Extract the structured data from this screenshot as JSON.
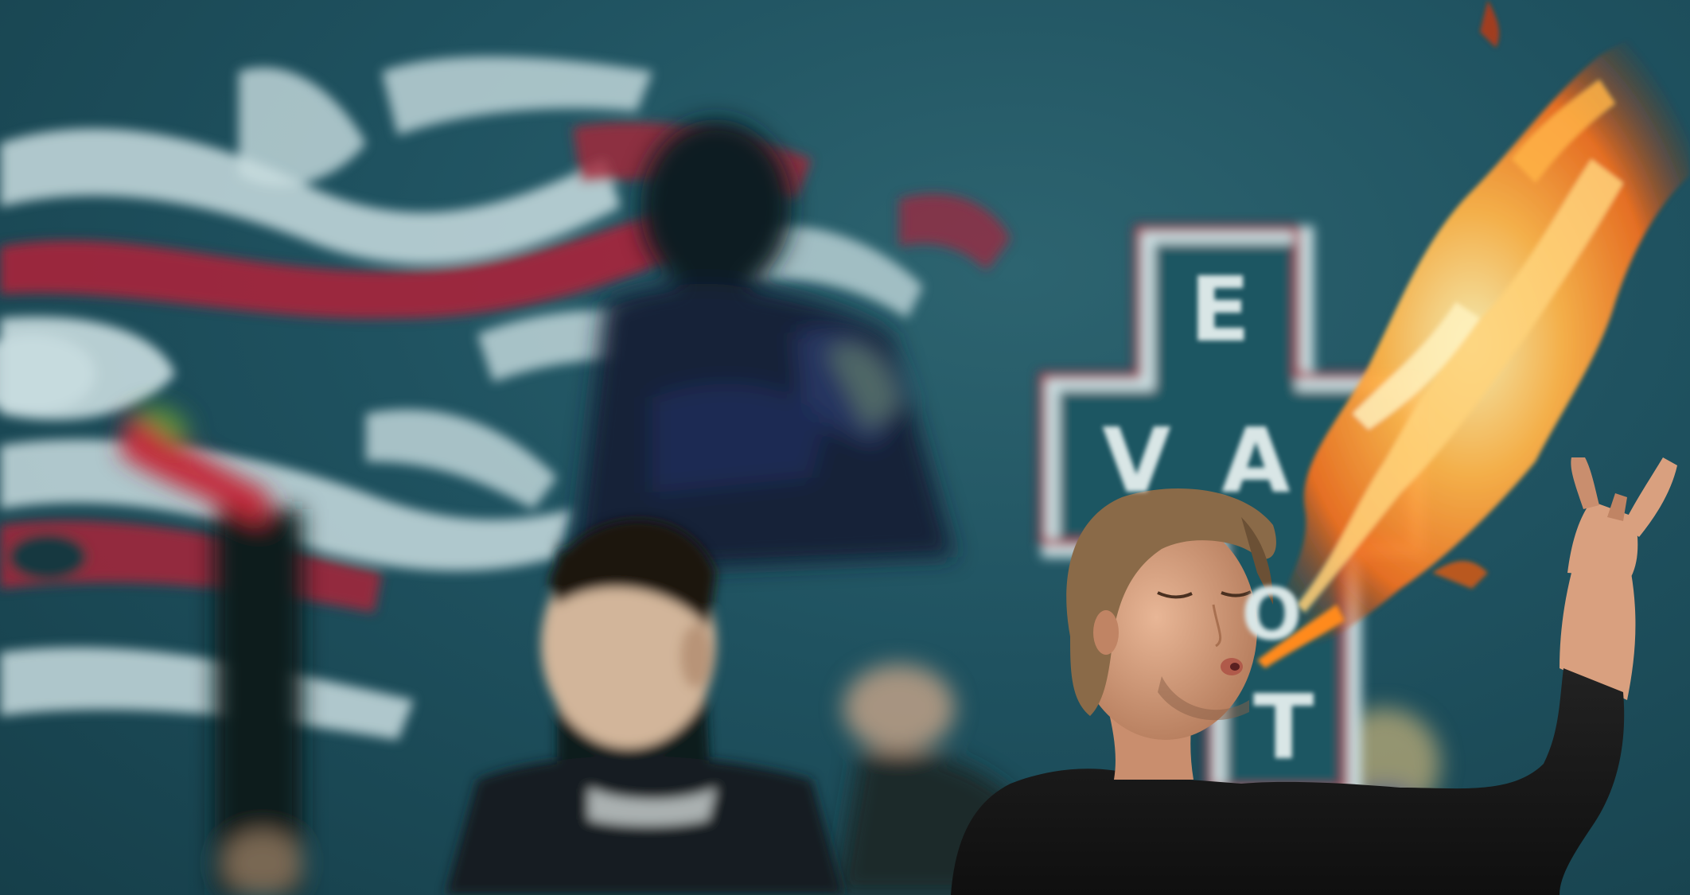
{
  "scene": {
    "description_free": true,
    "sign_letters": [
      "E",
      "V",
      "A",
      "O",
      "T"
    ],
    "colors": {
      "wall": "#1f5260",
      "graffiti_red": "#a8243a",
      "graffiti_white": "#c9dde0",
      "fire_core": "#ffd27a",
      "fire_mid": "#ff8a1e",
      "fire_edge": "#c23a0a",
      "shirt": "#181818",
      "skin": "#d9a07f",
      "hair": "#8a6a48"
    }
  }
}
